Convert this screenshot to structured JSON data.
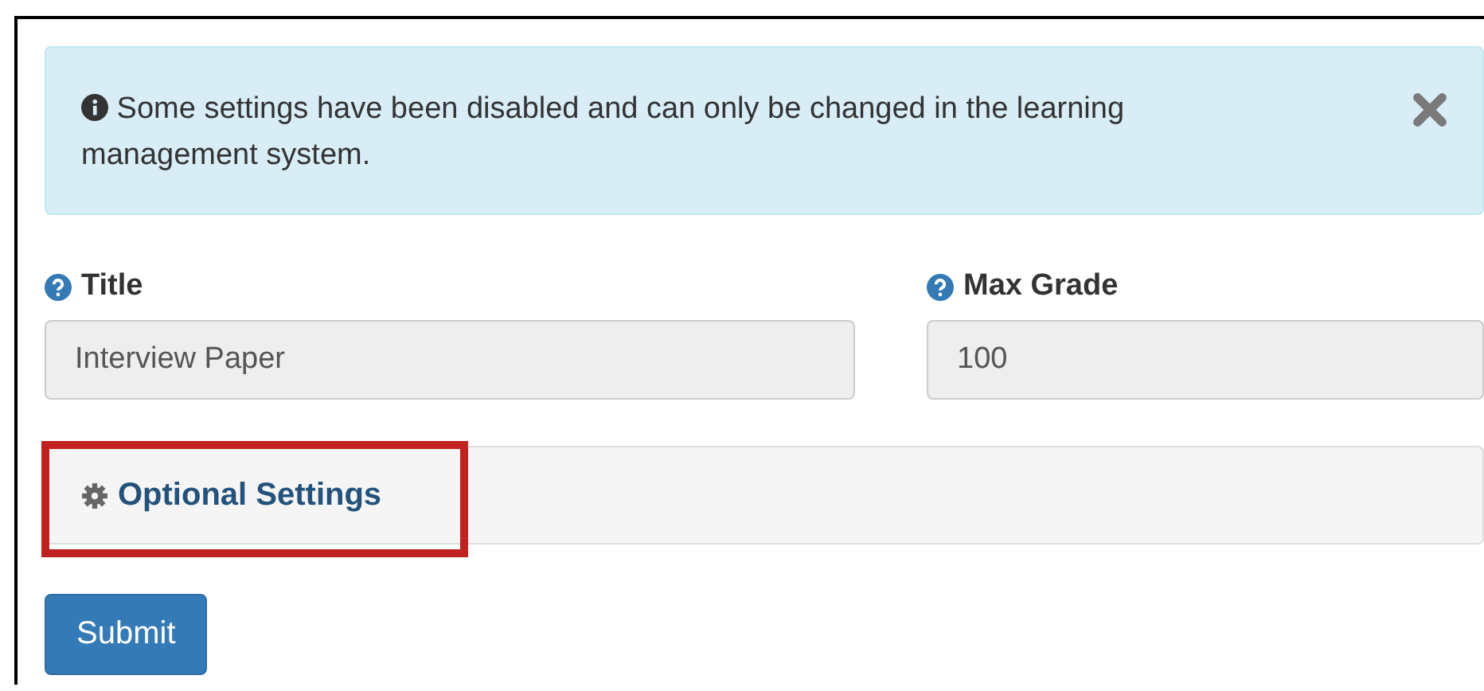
{
  "alert": {
    "message": "Some settings have been disabled and can only be changed in the learning management system.",
    "dismissible": true
  },
  "fields": [
    {
      "label": "Title",
      "value": "Interview Paper",
      "disabled": true
    },
    {
      "label": "Max Grade",
      "value": "100",
      "disabled": true
    }
  ],
  "optional_settings": {
    "label": "Optional Settings",
    "highlighted": true
  },
  "buttons": [
    "Submit"
  ]
}
